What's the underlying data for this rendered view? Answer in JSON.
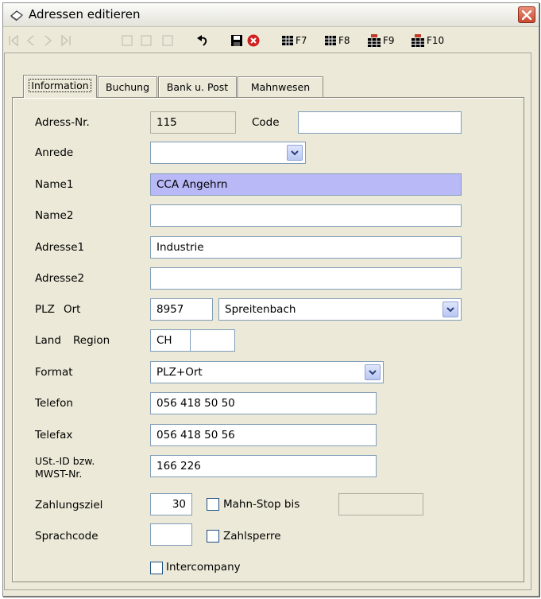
{
  "window": {
    "title": "Adressen editieren"
  },
  "toolbar": {
    "buttons": [
      {
        "label": "F7"
      },
      {
        "label": "F8"
      },
      {
        "label": "F9"
      },
      {
        "label": "F10"
      }
    ]
  },
  "tabs": [
    {
      "label": "Information",
      "active": true
    },
    {
      "label": "Buchung",
      "active": false
    },
    {
      "label": "Bank u. Post",
      "active": false
    },
    {
      "label": "Mahnwesen",
      "active": false
    }
  ],
  "form": {
    "adress_nr": {
      "label": "Adress-Nr.",
      "value": "115"
    },
    "code": {
      "label": "Code",
      "value": ""
    },
    "anrede": {
      "label": "Anrede",
      "value": ""
    },
    "name1": {
      "label": "Name1",
      "value": "CCA Angehrn"
    },
    "name2": {
      "label": "Name2",
      "value": ""
    },
    "adresse1": {
      "label": "Adresse1",
      "value": "Industrie"
    },
    "adresse2": {
      "label": "Adresse2",
      "value": ""
    },
    "plz": {
      "label": "PLZ",
      "value": "8957"
    },
    "ort": {
      "label": "Ort",
      "value": "Spreitenbach"
    },
    "land": {
      "label": "Land",
      "value": "CH"
    },
    "region": {
      "label": "Region",
      "value": ""
    },
    "format": {
      "label": "Format",
      "value": "PLZ+Ort"
    },
    "telefon": {
      "label": "Telefon",
      "value": "056 418 50 50"
    },
    "telefax": {
      "label": "Telefax",
      "value": "056 418 50 56"
    },
    "ust_id": {
      "label_line1": "USt.-ID bzw.",
      "label_line2": "MWST-Nr.",
      "value": "166 226"
    },
    "zahlungsziel": {
      "label": "Zahlungsziel",
      "value": "30"
    },
    "mahn_stop": {
      "label": "Mahn-Stop bis",
      "checked": false,
      "value": ""
    },
    "sprachcode": {
      "label": "Sprachcode",
      "value": ""
    },
    "zahlsperre": {
      "label": "Zahlsperre",
      "checked": false
    },
    "intercompany": {
      "label": "Intercompany",
      "checked": false
    }
  }
}
